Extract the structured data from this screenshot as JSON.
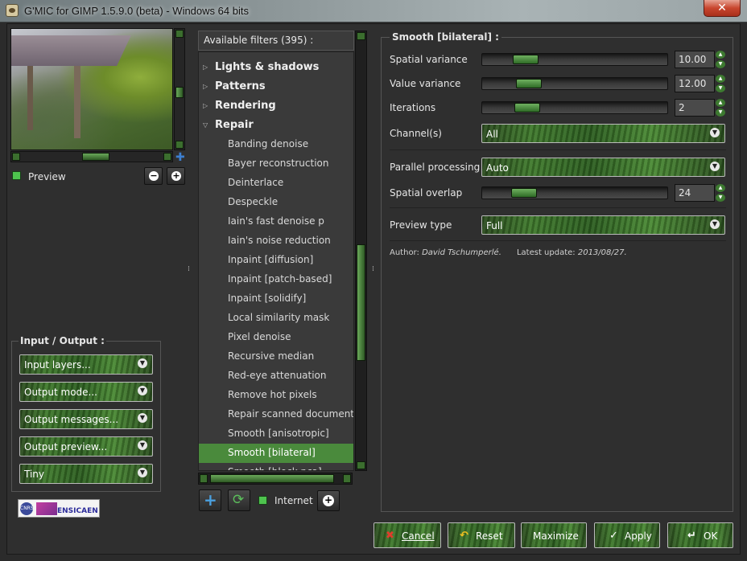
{
  "window": {
    "title": "G'MIC for GIMP 1.5.9.0 (beta) - Windows 64 bits",
    "close_glyph": "✕"
  },
  "preview": {
    "label": "Preview"
  },
  "io": {
    "title": "Input / Output :",
    "input_layers": "Input layers...",
    "output_mode": "Output mode...",
    "output_messages": "Output messages...",
    "output_preview": "Output preview...",
    "preview_size": "Tiny"
  },
  "filters": {
    "header": "Available filters (395) :",
    "categories": [
      {
        "label": "Lights & shadows",
        "expanded": false
      },
      {
        "label": "Patterns",
        "expanded": false
      },
      {
        "label": "Rendering",
        "expanded": false
      },
      {
        "label": "Repair",
        "expanded": true
      }
    ],
    "items": [
      "Banding denoise",
      "Bayer reconstruction",
      "Deinterlace",
      "Despeckle",
      "Iain's fast denoise p",
      "Iain's noise reduction",
      "Inpaint [diffusion]",
      "Inpaint [patch-based]",
      "Inpaint [solidify]",
      "Local similarity mask",
      "Pixel denoise",
      "Recursive median",
      "Red-eye attenuation",
      "Remove hot pixels",
      "Repair scanned document",
      "Smooth [anisotropic]",
      "Smooth [bilateral]",
      "Smooth [block pca]"
    ],
    "selected": "Smooth [bilateral]",
    "internet_label": "Internet"
  },
  "params": {
    "title": "Smooth [bilateral] :",
    "spatial_variance": {
      "label": "Spatial variance",
      "value": "10.00",
      "fraction": 0.1
    },
    "value_variance": {
      "label": "Value variance",
      "value": "12.00",
      "fraction": 0.12
    },
    "iterations": {
      "label": "Iterations",
      "value": "2",
      "fraction": 0.11
    },
    "channels": {
      "label": "Channel(s)",
      "value": "All"
    },
    "parallel": {
      "label": "Parallel processing",
      "value": "Auto"
    },
    "spatial_overlap": {
      "label": "Spatial overlap",
      "value": "24",
      "fraction": 0.09
    },
    "preview_type": {
      "label": "Preview type",
      "value": "Full"
    },
    "author_label": "Author:",
    "author": "David Tschumperlé.",
    "update_label": "Latest update:",
    "update": "2013/08/27."
  },
  "buttons": {
    "cancel": "Cancel",
    "reset": "Reset",
    "maximize": "Maximize",
    "apply": "Apply",
    "ok": "OK"
  },
  "logo": {
    "text1": "CNRS",
    "text2": "ENSICAEN"
  },
  "colors": {
    "accent_green": "#4a8a3c",
    "check_green": "#4ec34e",
    "background": "#2f2f2f"
  }
}
